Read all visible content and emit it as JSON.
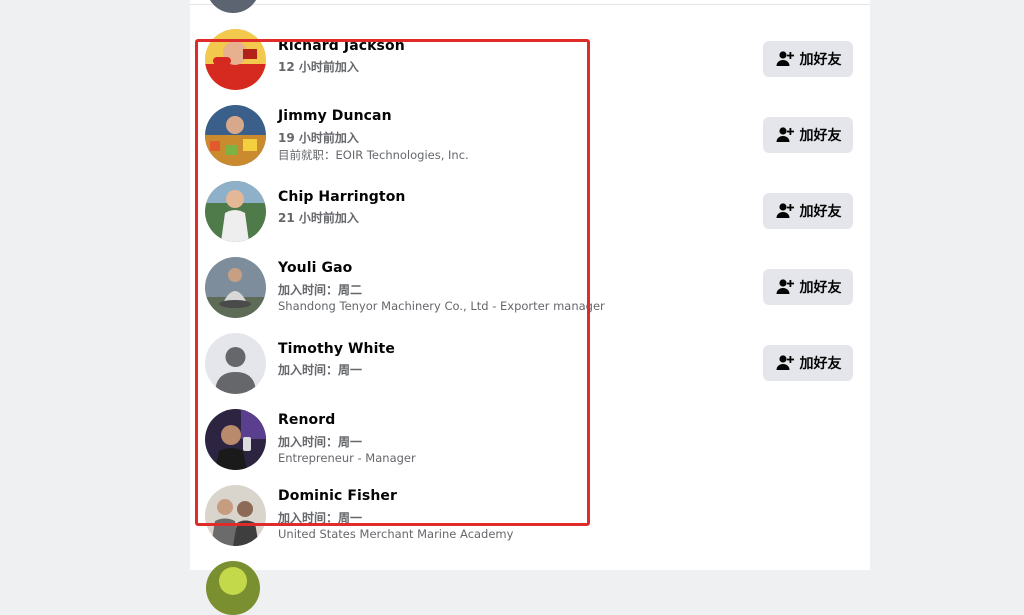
{
  "members": [
    {
      "name": "Richard Jackson",
      "joined": "12 小时前加入",
      "detail": "",
      "button": "加好友",
      "avatar": "photo-red-shirt"
    },
    {
      "name": "Jimmy Duncan",
      "joined": "19 小时前加入",
      "detail": "目前就职：EOIR Technologies, Inc.",
      "button": "加好友",
      "avatar": "photo-market"
    },
    {
      "name": "Chip Harrington",
      "joined": "21 小时前加入",
      "detail": "",
      "button": "加好友",
      "avatar": "photo-outdoor"
    },
    {
      "name": "Youli Gao",
      "joined": "加入时间：周二",
      "detail": "Shandong Tenyor Machinery Co., Ltd - Exporter manager",
      "button": "加好友",
      "avatar": "photo-meditation"
    },
    {
      "name": "Timothy White",
      "joined": "加入时间：周一",
      "detail": "",
      "button": "加好友",
      "avatar": "default-avatar-icon"
    },
    {
      "name": "Renord",
      "joined": "加入时间：周一",
      "detail": "Entrepreneur - Manager",
      "button": "",
      "avatar": "photo-selfie"
    },
    {
      "name": "Dominic Fisher",
      "joined": "加入时间：周一",
      "detail": "United States Merchant Marine Academy",
      "button": "",
      "avatar": "photo-group"
    }
  ],
  "colors": {
    "highlight": "#e02b2b",
    "button_bg": "#e4e6eb",
    "secondary_text": "#65676b"
  }
}
